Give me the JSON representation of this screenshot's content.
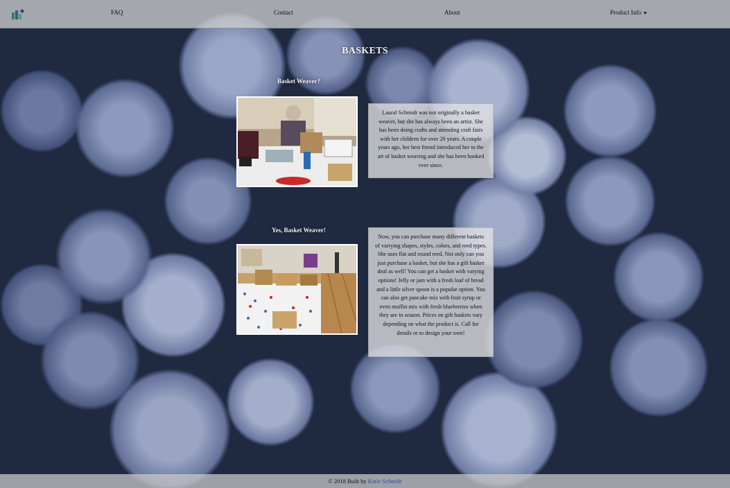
{
  "nav": {
    "faq": "FAQ",
    "contact": "Contact",
    "about": "About",
    "product_info": "Product Info"
  },
  "page": {
    "title": "BASKETS"
  },
  "sections": [
    {
      "heading": "Basket Weaver?",
      "text": "Laural Schmidt was not originally a basket weaver, but she has always been an artist. She has been doing crafts and attending craft fairs with her children for over 20 years. A couple years ago, her best friend introduced her to the art of basket weaving and she has been hooked ever since."
    },
    {
      "heading": "Yes, Basket Weaver!",
      "text": "Now, you can purchase many different baskets of varrying shapes, styles, colors, and reed types. She uses flat and round reed. Not only can you just purchase a basket, but she has a gift basket deal as well! You can get a basket with varying options! Jelly or jam with a fresh loaf of bread and a little silver spoon is a popular option. You can also get pancake mix with fruit syrup or even muffin mix with fresh blueberries when they are in season. Prices on gift baskets vary depending on what the product is. Call for details or to design your own!"
    }
  ],
  "footer": {
    "prefix": "© 2018 Built by ",
    "author": "Katie Schmidt"
  }
}
